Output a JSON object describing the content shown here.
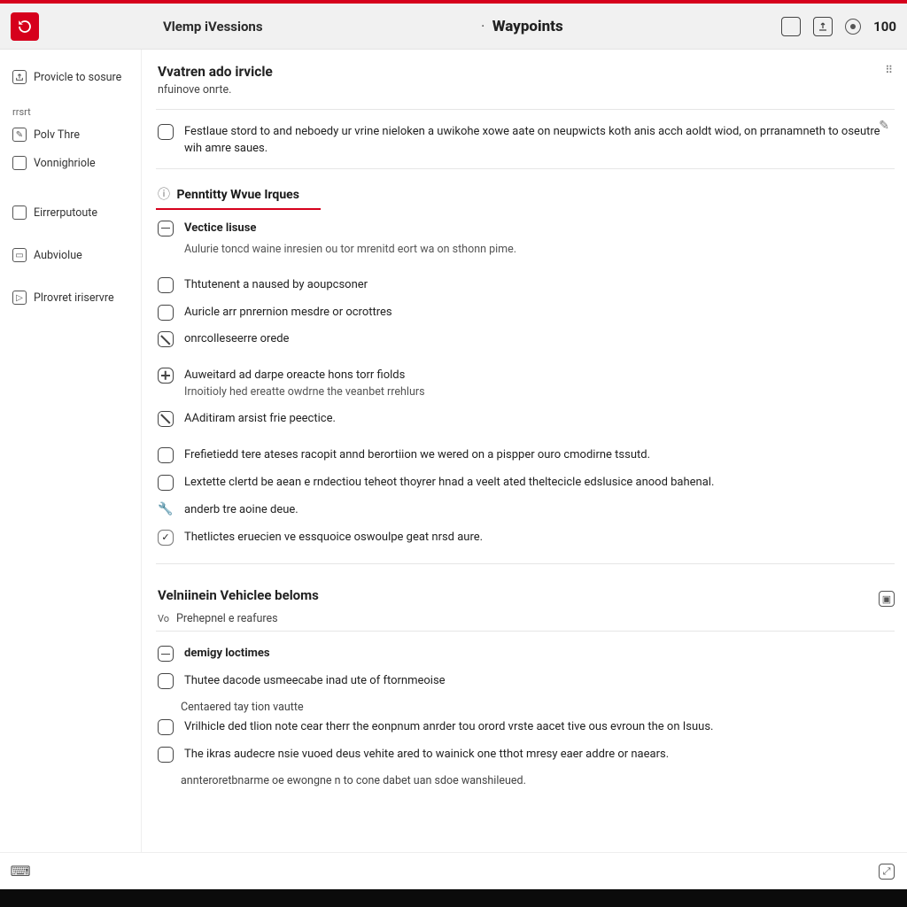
{
  "header": {
    "left_label": "Vlemp iVessions",
    "center_title": "Waypoints",
    "count": "100"
  },
  "sidebar": {
    "top_item": "Provicle to sosure",
    "section1_label": "rrsrt",
    "items": [
      "Polv Thre",
      "Vonnighriole",
      "Eirrerputoute",
      "Aubviolue",
      "Plrovret iriservre"
    ]
  },
  "panel": {
    "title": "Vvatren ado irvicle",
    "subtitle": "nfuinove onrte.",
    "intro_row": "Festlaue stord to and neboedy ur vrine nieloken a uwikohe xowe aate on neupwicts koth anis acch aoldt wiod, on prranamneth to oseutre wih amre saues."
  },
  "tab": {
    "label": "Penntitty Wvue Irques"
  },
  "block1": {
    "title": "Vectice lisuse",
    "sub": "Aulurie toncd waine inresien ou tor mrenitd eort wa on sthonn pime."
  },
  "rows_a": [
    "Thtutenent a naused by aoupcsoner",
    "Auricle arr pnrernion mesdre or ocrottres",
    "onrcolleseerre orede"
  ],
  "rows_b": {
    "l1": "Auweitard ad darpe oreacte hons torr fiolds",
    "l2": "Irnoitioly hed ereatte owdrne the veanbet rrehlurs",
    "l3": "AAditiram arsist frie peectice."
  },
  "rows_c": [
    "Frefietiedd tere ateses racopit annd berortiion we wered on a pispper ouro cmodirne tssutd.",
    "Lextette clertd be aean e rndectiou teheot thoyrer hnad a veelt ated theltecicle edslusice anood bahenal.",
    "anderb tre aoine deue.",
    "Thetlictes eruecien ve essquoice oswoulpe geat nrsd aure."
  ],
  "section2": {
    "title": "Velniinein Vehiclee beloms",
    "vo": "Vo",
    "sub": "Prehepnel e reafures"
  },
  "rows_d": {
    "b0": "demigy loctimes",
    "b1": "Thutee dacode usmeecabe inad ute of ftornmeoise",
    "ind": "Centaered tay tion vautte",
    "b2": "Vrilhicle ded tlion note cear therr the eonpnum anrder tou orord vrste aacet tive ous evroun the on Isuus.",
    "b3": "The ikras audecre nsie vuoed deus vehite ared to wainick one tthot mresy eaer addre or naears.",
    "ind2": "annteroretbnarme oe ewongne n to cone dabet uan sdoe wanshileued."
  }
}
